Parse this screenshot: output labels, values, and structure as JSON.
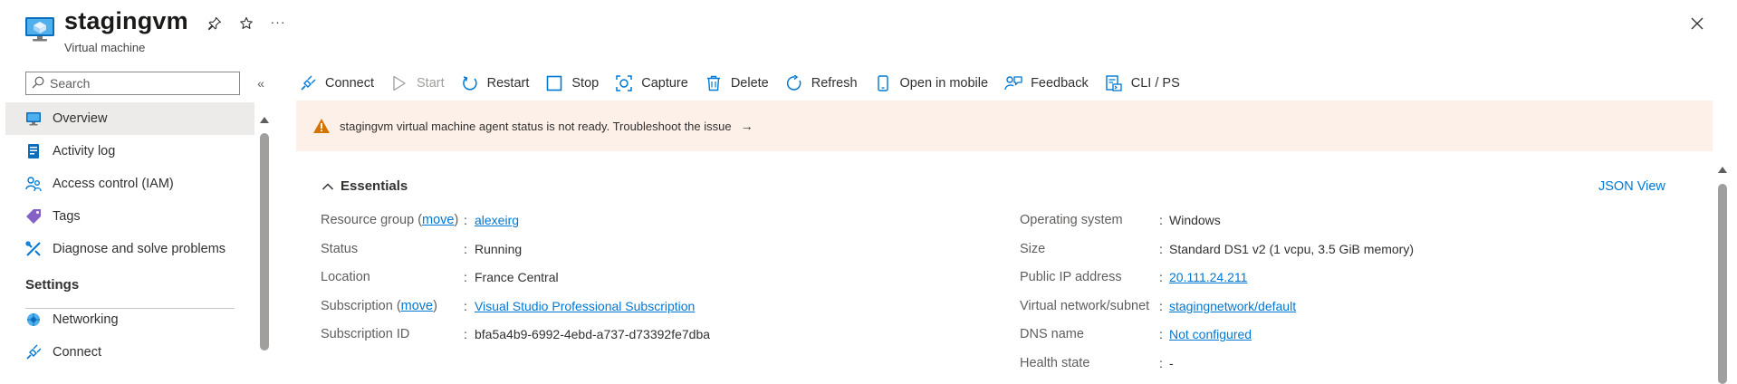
{
  "header": {
    "title": "stagingvm",
    "subtitle": "Virtual machine",
    "pin_icon": "pin-icon",
    "favorite_icon": "star-icon",
    "more_icon": "more-icon",
    "more_label": "···",
    "close_icon": "close-icon"
  },
  "sidebar": {
    "search": {
      "placeholder": "Search",
      "value": ""
    },
    "collapse_label": "«",
    "items": [
      {
        "label": "Overview",
        "icon": "monitor-icon",
        "active": true
      },
      {
        "label": "Activity log",
        "icon": "activity-log-icon",
        "active": false
      },
      {
        "label": "Access control (IAM)",
        "icon": "people-icon",
        "active": false
      },
      {
        "label": "Tags",
        "icon": "tag-icon",
        "active": false
      },
      {
        "label": "Diagnose and solve problems",
        "icon": "wrench-icon",
        "active": false
      }
    ],
    "section_settings": "Settings",
    "settings_items": [
      {
        "label": "Networking",
        "icon": "network-icon"
      },
      {
        "label": "Connect",
        "icon": "plug-icon"
      }
    ]
  },
  "toolbar": {
    "buttons": [
      {
        "label": "Connect",
        "icon": "plug-icon",
        "enabled": true
      },
      {
        "label": "Start",
        "icon": "play-icon",
        "enabled": false
      },
      {
        "label": "Restart",
        "icon": "restart-icon",
        "enabled": true
      },
      {
        "label": "Stop",
        "icon": "stop-icon",
        "enabled": true
      },
      {
        "label": "Capture",
        "icon": "capture-icon",
        "enabled": true
      },
      {
        "label": "Delete",
        "icon": "trash-icon",
        "enabled": true
      },
      {
        "label": "Refresh",
        "icon": "refresh-icon",
        "enabled": true
      },
      {
        "label": "Open in mobile",
        "icon": "mobile-icon",
        "enabled": true
      },
      {
        "label": "Feedback",
        "icon": "feedback-icon",
        "enabled": true
      },
      {
        "label": "CLI / PS",
        "icon": "cli-icon",
        "enabled": true
      }
    ]
  },
  "banner": {
    "text": "stagingvm virtual machine agent status is not ready. Troubleshoot the issue",
    "arrow": "→",
    "icon": "warning-icon"
  },
  "essentials": {
    "title": "Essentials",
    "json_view": "JSON View",
    "left": [
      {
        "key": "Resource group",
        "key_link": "move",
        "value": "alexeirg",
        "value_is_link": true
      },
      {
        "key": "Status",
        "value": "Running",
        "value_is_link": false
      },
      {
        "key": "Location",
        "value": "France Central",
        "value_is_link": false
      },
      {
        "key": "Subscription",
        "key_link": "move",
        "value": "Visual Studio Professional Subscription",
        "value_is_link": true
      },
      {
        "key": "Subscription ID",
        "value": "bfa5a4b9-6992-4ebd-a737-d73392fe7dba",
        "value_is_link": false
      }
    ],
    "right": [
      {
        "key": "Operating system",
        "value": "Windows",
        "value_is_link": false
      },
      {
        "key": "Size",
        "value": "Standard DS1 v2 (1 vcpu, 3.5 GiB memory)",
        "value_is_link": false
      },
      {
        "key": "Public IP address",
        "value": "20.111.24.211",
        "value_is_link": true
      },
      {
        "key": "Virtual network/subnet",
        "value": "stagingnetwork/default",
        "value_is_link": true
      },
      {
        "key": "DNS name",
        "value": "Not configured",
        "value_is_link": true
      },
      {
        "key": "Health state",
        "value": "-",
        "value_is_link": false
      }
    ]
  },
  "colors": {
    "accent": "#0078d4",
    "warning_bg": "#fdf0e8",
    "warning_icon": "#d47500",
    "active_nav_bg": "#edebe9"
  }
}
